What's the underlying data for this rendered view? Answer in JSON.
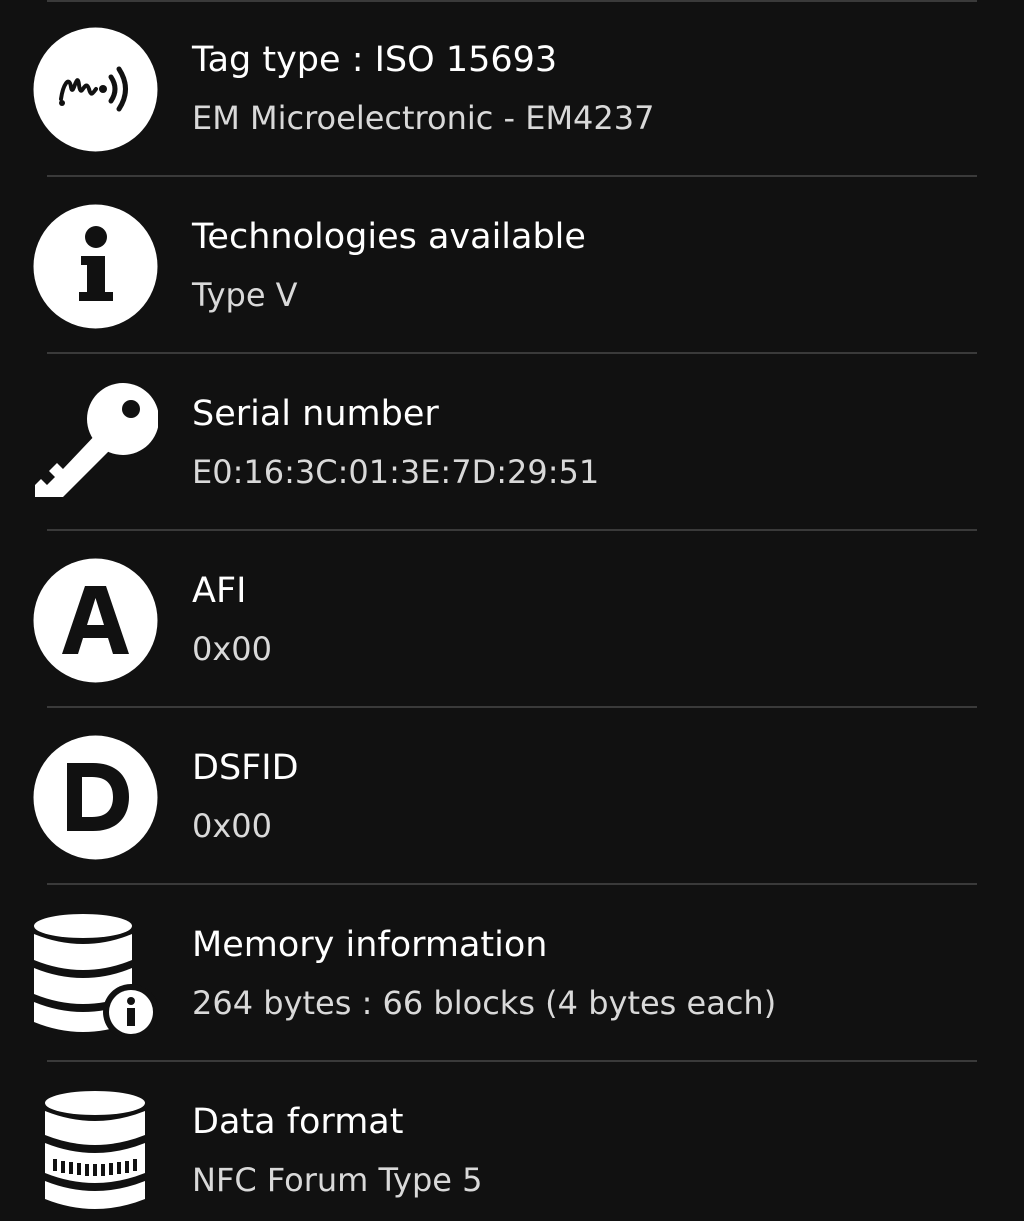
{
  "rows": [
    {
      "icon": "nfc-sound-wave-icon",
      "title": "Tag type : ISO 15693",
      "value": "EM Microelectronic - EM4237"
    },
    {
      "icon": "info-icon",
      "title": "Technologies available",
      "value": "Type V"
    },
    {
      "icon": "key-icon",
      "title": "Serial number",
      "value": "E0:16:3C:01:3E:7D:29:51"
    },
    {
      "icon": "letter-a-icon",
      "title": "AFI",
      "value": "0x00"
    },
    {
      "icon": "letter-d-icon",
      "title": "DSFID",
      "value": "0x00"
    },
    {
      "icon": "database-info-icon",
      "title": "Memory information",
      "value": "264 bytes : 66 blocks (4 bytes each)"
    },
    {
      "icon": "database-format-icon",
      "title": "Data format",
      "value": "NFC Forum Type 5"
    }
  ],
  "colors": {
    "background": "#111111",
    "title": "#ffffff",
    "value": "#d9d9d9",
    "separator": "#3a3a3a"
  }
}
